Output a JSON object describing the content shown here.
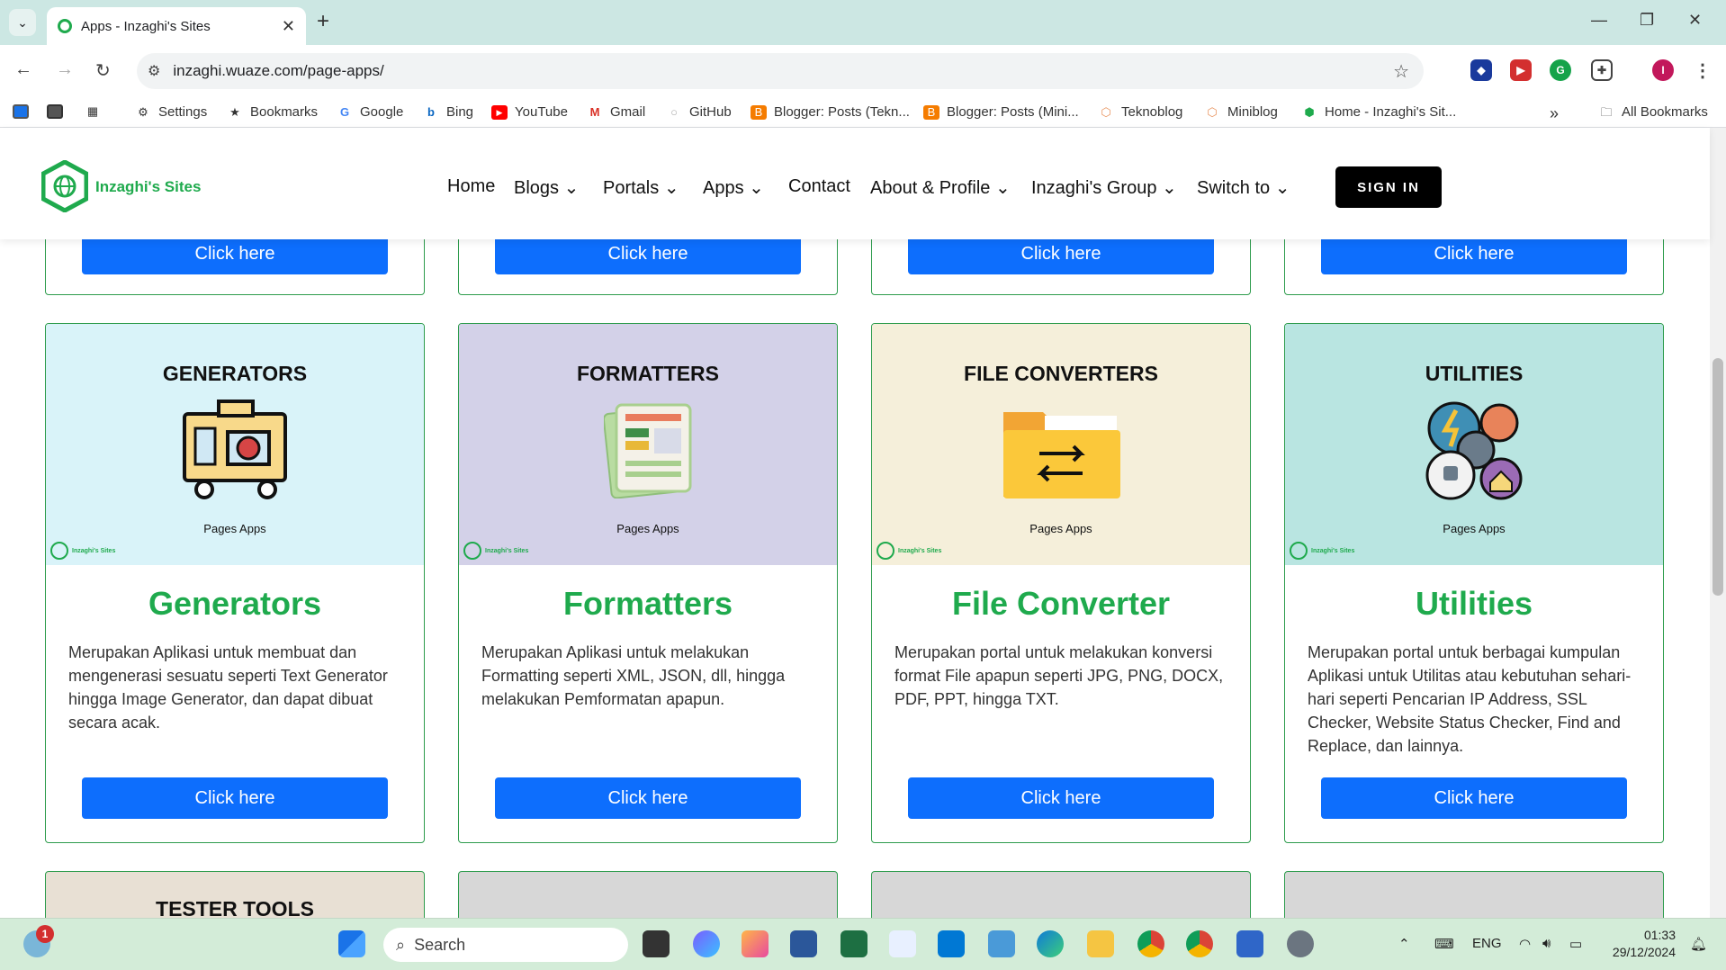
{
  "browser": {
    "tab_title": "Apps - Inzaghi's Sites",
    "url": "inzaghi.wuaze.com/page-apps/",
    "bookmarks": [
      "Settings",
      "Bookmarks",
      "Google",
      "Bing",
      "YouTube",
      "Gmail",
      "GitHub",
      "Blogger: Posts (Tekn...",
      "Blogger: Posts (Mini...",
      "Teknoblog",
      "Miniblog",
      "Home - Inzaghi's Sit..."
    ],
    "all_bookmarks": "All Bookmarks",
    "profile_initial": "I"
  },
  "site": {
    "logo_text": "Inzaghi's Sites",
    "nav": [
      "Home",
      "Blogs",
      "Portals",
      "Apps",
      "Contact",
      "About & Profile",
      "Inzaghi's Group",
      "Switch to"
    ],
    "signin": "SIGN IN"
  },
  "top_row_buttons": [
    "Click here",
    "Click here",
    "Click here",
    "Click here"
  ],
  "cards": [
    {
      "image_label": "GENERATORS",
      "caption": "Pages Apps",
      "mini_logo": "Inzaghi's Sites",
      "title": "Generators",
      "desc": "Merupakan Aplikasi untuk membuat dan mengenerasi sesuatu seperti Text Generator hingga Image Generator, dan dapat dibuat secara acak.",
      "button": "Click here",
      "bg": "#d9f3f9"
    },
    {
      "image_label": "FORMATTERS",
      "caption": "Pages Apps",
      "mini_logo": "Inzaghi's Sites",
      "title": "Formatters",
      "desc": "Merupakan Aplikasi untuk melakukan Formatting seperti XML, JSON, dll, hingga melakukan Pemformatan apapun.",
      "button": "Click here",
      "bg": "#d3d1e8"
    },
    {
      "image_label": "FILE CONVERTERS",
      "caption": "Pages Apps",
      "mini_logo": "Inzaghi's Sites",
      "title": "File Converter",
      "desc": "Merupakan portal untuk melakukan konversi format File apapun seperti JPG, PNG, DOCX, PDF, PPT, hingga TXT.",
      "button": "Click here",
      "bg": "#f5efda"
    },
    {
      "image_label": "UTILITIES",
      "caption": "Pages Apps",
      "mini_logo": "Inzaghi's Sites",
      "title": "Utilities",
      "desc": "Merupakan portal untuk berbagai kumpulan Aplikasi untuk Utilitas atau kebutuhan sehari-hari seperti Pencarian IP Address, SSL Checker, Website Status Checker, Find and Replace, dan lainnya.",
      "button": "Click here",
      "bg": "#b9e5e1"
    }
  ],
  "bottom_row": {
    "first_label": "TESTER TOOLS"
  },
  "taskbar": {
    "search_placeholder": "Search",
    "lang": "ENG",
    "time": "01:33",
    "date": "29/12/2024",
    "notification_badge": "1"
  },
  "colors": {
    "accent_green": "#1faa4d",
    "button_blue": "#0d6efd"
  }
}
